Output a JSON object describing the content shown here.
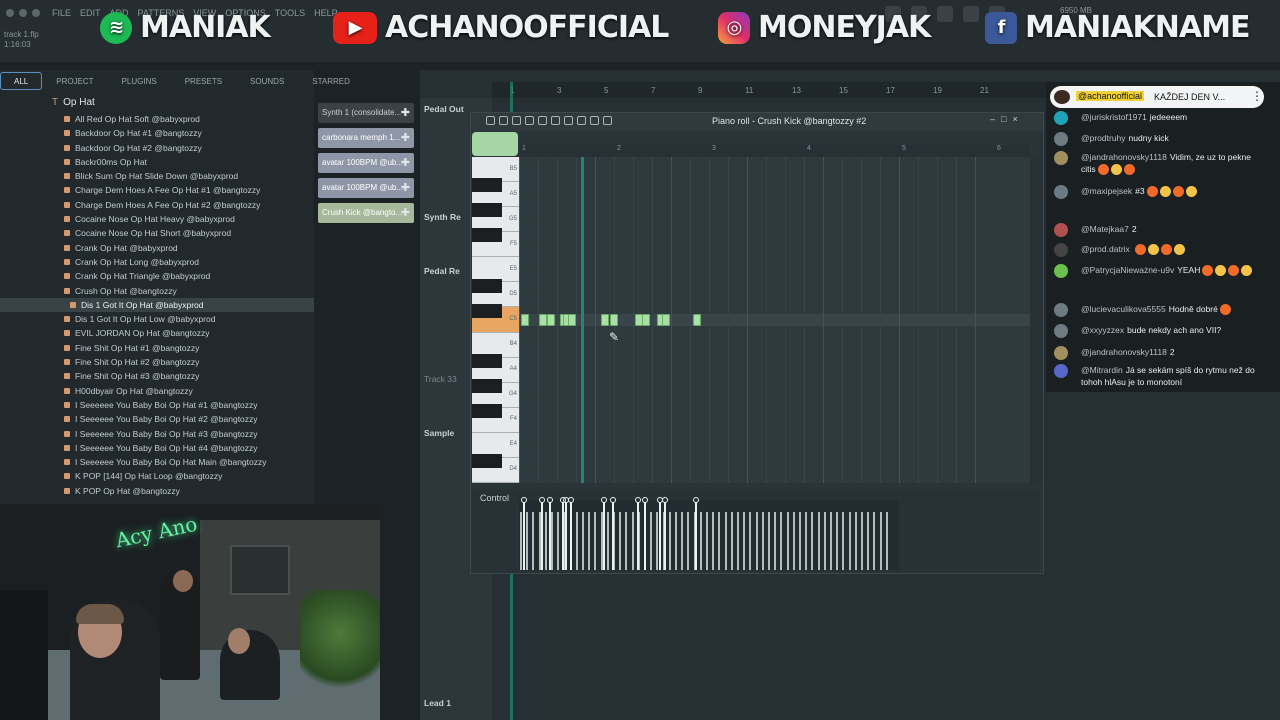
{
  "window": {
    "menu": [
      "FILE",
      "EDIT",
      "ADD",
      "PATTERNS",
      "VIEW",
      "OPTIONS",
      "TOOLS",
      "HELP"
    ],
    "song_title": "track 1.flp",
    "song_time": "1:16:03",
    "memory": "6950 MB"
  },
  "overlay": {
    "spotify": "MANIAK",
    "youtube": "ACHANOOFFICIAL",
    "instagram": "MONEYJAK",
    "facebook": "MANIAKNAME"
  },
  "browser": {
    "tabs": [
      "ALL",
      "PROJECT",
      "PLUGINS",
      "PRESETS",
      "SOUNDS",
      "STARRED"
    ],
    "folder": "Op Hat",
    "files": [
      "All Red Op Hat Soft @babyxprod",
      "Backdoor Op Hat #1 @bangtozzy",
      "Backdoor Op Hat #2 @bangtozzy",
      "Backr00ms Op Hat",
      "Blick Sum Op Hat Slide Down @babyxprod",
      "Charge Dem Hoes A Fee Op Hat #1 @bangtozzy",
      "Charge Dem Hoes A Fee Op Hat #2 @bangtozzy",
      "Cocaine Nose Op Hat Heavy @babyxprod",
      "Cocaine Nose Op Hat Short @babyxprod",
      "Crank Op Hat @babyxprod",
      "Crank Op Hat Long @babyxprod",
      "Crank Op Hat Triangle @babyxprod",
      "Crush Op Hat @bangtozzy",
      "Dis 1 Got It Op Hat @babyxprod",
      "Dis 1 Got It Op Hat Low @babyxprod",
      "EVIL JORDAN Op Hat @bangtozzy",
      "Fine Shit Op Hat #1 @bangtozzy",
      "Fine Shit Op Hat #2 @bangtozzy",
      "Fine Shit Op Hat #3 @bangtozzy",
      "H00dbyair Op Hat @bangtozzy",
      "I Seeeeee You Baby Boi Op Hat #1 @bangtozzy",
      "I Seeeeee You Baby Boi Op Hat #2 @bangtozzy",
      "I Seeeeee You Baby Boi Op Hat #3 @bangtozzy",
      "I Seeeeee You Baby Boi Op Hat #4 @bangtozzy",
      "I Seeeeee You Baby Boi Op Hat Main @bangtozzy",
      "K POP [144] Op Hat Loop @bangtozzy",
      "K POP Op Hat @bangtozzy"
    ],
    "selected_index": 13
  },
  "rack": {
    "channels": [
      "Synth 1 (consolidate...",
      "carbonara memph 1...",
      "avatar 100BPM @ub...",
      "avatar 100BPM @ub...",
      "Crush Kick @bangto..."
    ]
  },
  "playlist": {
    "tracks": [
      "Pedal Out",
      "Synth Re",
      "Pedal Re",
      "Track 33",
      "Sample",
      "Lead 1"
    ],
    "ruler": [
      "1",
      "3",
      "5",
      "7",
      "9",
      "11",
      "13",
      "15",
      "17",
      "19",
      "21"
    ]
  },
  "piano_roll": {
    "title": "Piano roll - Crush Kick @bangtozzy #2",
    "bars": [
      "1",
      "2",
      "3",
      "4",
      "5",
      "6"
    ],
    "key_labels": [
      "B5",
      "A5",
      "G5",
      "F5",
      "E5",
      "D5",
      "C5",
      "B4",
      "A4",
      "G4",
      "F4",
      "E4",
      "D4"
    ],
    "control_label": "Control",
    "note_starts": [
      0.2,
      2.1,
      2.9,
      4.3,
      4.6,
      5.2,
      8.6,
      9.6,
      12.2,
      12.9,
      14.5,
      15.0,
      18.3
    ]
  },
  "chat": {
    "pinned_user": "@achanoofficial",
    "pinned_text": "KAŽDEJ DEN V...",
    "messages": [
      {
        "user": "@juriskristof1971",
        "text": "jedeeeem"
      },
      {
        "user": "@prodtruhy",
        "text": "nudny kick"
      },
      {
        "user": "@jandrahonovsky1118",
        "text": "Vidim, ze uz to pekne citis"
      },
      {
        "user": "@maxipejsek",
        "text": "#3"
      },
      {
        "user": "@Matejkaa7",
        "text": "2"
      },
      {
        "user": "@prod.datrix",
        "text": ""
      },
      {
        "user": "@PatrycjaNieważne-u9v",
        "text": "YEAH"
      },
      {
        "user": "@lucievaculikova5555",
        "text": "Hodně dobré"
      },
      {
        "user": "@xxyyzzex",
        "text": "bude nekdy ach ano VII?"
      },
      {
        "user": "@jandrahonovsky1118",
        "text": "2"
      },
      {
        "user": "@Mitrardin",
        "text": "Já se sekám spíš do rytmu než do tohoh hlAsu je to monotoní"
      }
    ]
  },
  "webcam": {
    "neon_sign": "Acy Ano"
  },
  "colors": {
    "note": "#a8e0a5",
    "play_line": "#1c8a72",
    "c5_key": "#e9a662",
    "selected_tab_border": "#5f8fbf"
  }
}
